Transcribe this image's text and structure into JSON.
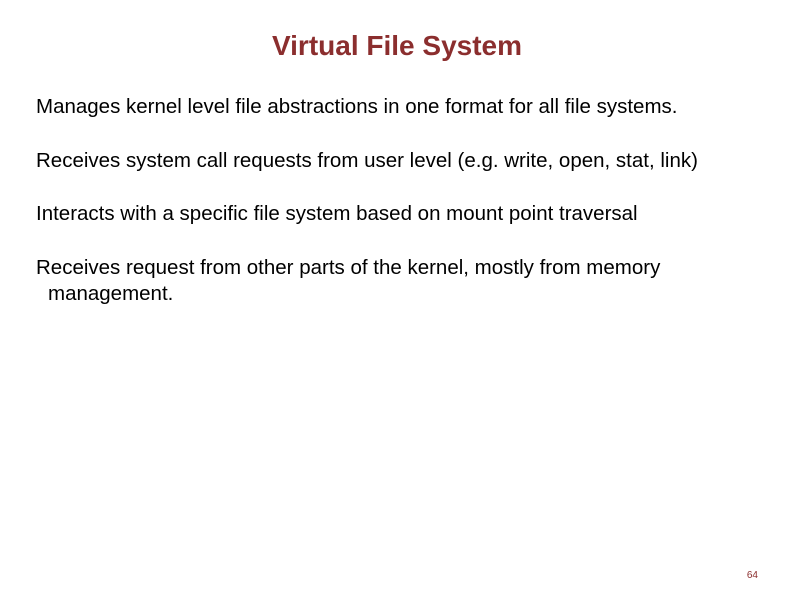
{
  "slide": {
    "title": "Virtual File System",
    "paragraphs": [
      "Manages kernel level file abstractions in one format for all file systems.",
      "Receives system call requests from user level (e.g. write, open, stat, link)",
      "Interacts with a specific file system based on mount point traversal",
      "Receives request from other parts of the kernel, mostly from memory management."
    ],
    "page_number": "64"
  }
}
